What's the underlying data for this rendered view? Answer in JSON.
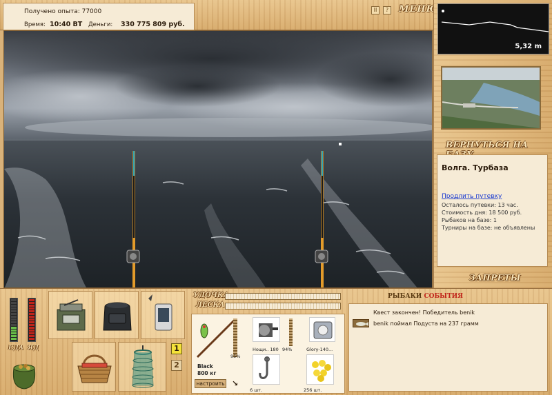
{
  "status": {
    "experience_label": "Получено опыта: 77000",
    "time_label": "Время:",
    "time_value": "10:40 ВТ",
    "money_label": "Деньги:",
    "money_value": "330 775 809 руб."
  },
  "header": {
    "pause_icon": "II",
    "help_icon": "?",
    "menu_label": "МЕНЮ"
  },
  "depth_panel": {
    "depth_value": "5,32 m"
  },
  "right_panel": {
    "return_label": "ВЕРНУТЬСЯ НА БАЗУ",
    "location_title": "Волга. Турбаза",
    "extend_link": "Продлить путевку",
    "remaining": "Осталось путевки: 13 час.",
    "day_cost": "Стоимость дня: 18 500 руб.",
    "fishers": "Рыбаков на базе: 1",
    "tournaments": "Турниры на базе: не объявлены",
    "bans_label": "ЗАПРЕТЫ"
  },
  "meters": {
    "food_label": "ЕДА",
    "poison_label": "ЯД",
    "food_level": 0.35,
    "poison_level": 1.0
  },
  "tackle": {
    "rod_label": "УДОЧКА",
    "line_label": "ЛЕСКА",
    "rod_name": "Black",
    "rod_weight": "800 кг",
    "rod_percent": "95%",
    "reel_name": "Нощи.. 180",
    "reel_percent": "94%",
    "line_name": "Glory-140...",
    "hook_count": "6 шт.",
    "bait_count": "256 шт.",
    "setup_button": "настроить"
  },
  "slots": {
    "slot1": "1",
    "slot2": "2"
  },
  "events": {
    "header_part1": "РЫБАКИ",
    "header_part2": "СОБЫТИЯ",
    "items": [
      "Квест закончен! Победитель benik",
      "benik поймал Подуста на 237 грамм"
    ]
  },
  "colors": {
    "accent_red": "#c0241a",
    "wood": "#ddb57a",
    "link": "#1a3ad0"
  }
}
